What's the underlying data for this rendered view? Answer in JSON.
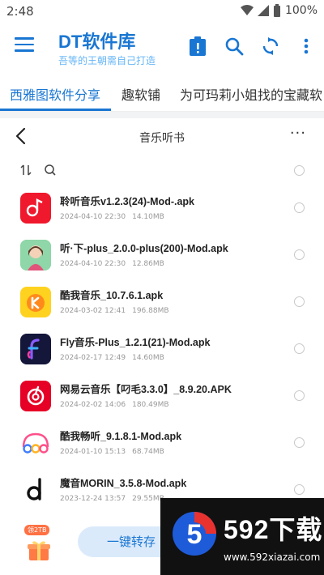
{
  "status_bar": {
    "time": "2:48",
    "battery": "100%"
  },
  "app_bar": {
    "title": "DT软件库",
    "subtitle": "吾等的王朝需自己打造"
  },
  "tabs": [
    {
      "label": "西雅图软件分享",
      "active": true
    },
    {
      "label": "趣软铺",
      "active": false
    },
    {
      "label": "为可玛莉小姐找的宝藏软",
      "active": false
    }
  ],
  "folder": {
    "title": "音乐听书",
    "more": "···"
  },
  "files": [
    {
      "name": "聆听音乐v1.2.3(24)-Mod-.apk",
      "date": "2024-04-10 22:30",
      "size": "14.10MB",
      "icon": "music-note-red"
    },
    {
      "name": "听·下-plus_2.0.0-plus(200)-Mod.apk",
      "date": "2024-04-10 22:30",
      "size": "12.86MB",
      "icon": "anime-girl"
    },
    {
      "name": "酷我音乐_10.7.6.1.apk",
      "date": "2024-03-02 12:41",
      "size": "196.88MB",
      "icon": "kuwo-yellow"
    },
    {
      "name": "Fly音乐-Plus_1.2.1(21)-Mod.apk",
      "date": "2024-02-17 12:49",
      "size": "14.60MB",
      "icon": "fly-f"
    },
    {
      "name": "网易云音乐【叼毛3.3.0】_8.9.20.APK",
      "date": "2024-02-02 14:06",
      "size": "180.49MB",
      "icon": "netease-red"
    },
    {
      "name": "酷我畅听_9.1.8.1-Mod.apk",
      "date": "2024-01-10 15:13",
      "size": "68.74MB",
      "icon": "cool-headphones"
    },
    {
      "name": "魔音MORIN_3.5.8-Mod.apk",
      "date": "2023-12-24 13:57",
      "size": "29.55MB",
      "icon": "morin-d"
    }
  ],
  "bottom": {
    "gift_badge": "领2TB",
    "transfer_label": "一键转存"
  },
  "watermark": {
    "brand": "592下载",
    "url": "www.592xiazai.com",
    "logo_letter": "5"
  },
  "colors": {
    "accent": "#1976d2",
    "light_accent": "#dbeafb"
  }
}
